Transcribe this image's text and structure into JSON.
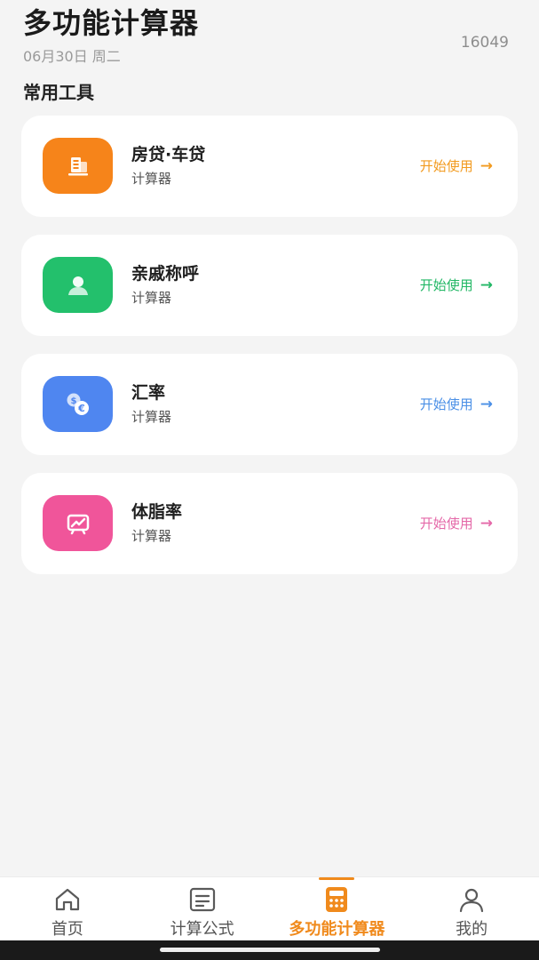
{
  "header": {
    "title": "多功能计算器",
    "date": "06月30日 周二",
    "counter": "16049"
  },
  "section_title": "常用工具",
  "tools": [
    {
      "title": "房贷·车贷",
      "subtitle": "计算器",
      "action": "开始使用",
      "arrow": "→",
      "icon": "building-card-icon",
      "tile_color": "#f6841a",
      "accent": "#f29a1e"
    },
    {
      "title": "亲戚称呼",
      "subtitle": "计算器",
      "action": "开始使用",
      "arrow": "→",
      "icon": "person-icon",
      "tile_color": "#23c06c",
      "accent": "#22b765"
    },
    {
      "title": "汇率",
      "subtitle": "计算器",
      "action": "开始使用",
      "arrow": "→",
      "icon": "currency-exchange-icon",
      "tile_color": "#4f86f0",
      "accent": "#4a8fe6"
    },
    {
      "title": "体脂率",
      "subtitle": "计算器",
      "action": "开始使用",
      "arrow": "→",
      "icon": "trend-chart-icon",
      "tile_color": "#f0559a",
      "accent": "#e468a8"
    }
  ],
  "nav": [
    {
      "label": "首页",
      "icon": "home-icon",
      "active": false
    },
    {
      "label": "计算公式",
      "icon": "document-icon",
      "active": false
    },
    {
      "label": "多功能计算器",
      "icon": "calculator-icon",
      "active": true
    },
    {
      "label": "我的",
      "icon": "user-icon",
      "active": false
    }
  ]
}
